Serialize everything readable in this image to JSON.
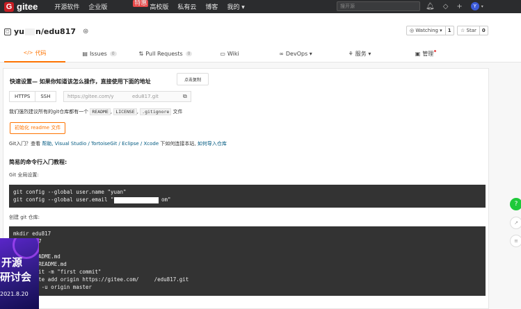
{
  "topnav": {
    "logo_mark": "G",
    "logo_text": "gitee",
    "links": [
      "开源软件",
      "企业版",
      "高校版",
      "私有云",
      "博客",
      "我的 ▾"
    ],
    "enterprise_badge": "特惠",
    "search_placeholder": "搜开源",
    "avatar_letter": "Y"
  },
  "repo": {
    "owner_prefix": "yu",
    "owner_suffix": "n",
    "separator": "/",
    "name": "edu817",
    "watch_label": "◎ Watching ▾",
    "watch_count": "1",
    "star_label": "☆ Star",
    "star_count": "0"
  },
  "tabs": [
    {
      "label": "代码",
      "icon": "</>"
    },
    {
      "label": "Issues",
      "count": "0"
    },
    {
      "label": "Pull Requests",
      "count": "0"
    },
    {
      "label": "Wiki"
    },
    {
      "label": "DevOps ▾"
    },
    {
      "label": "服务 ▾"
    },
    {
      "label": "管理"
    }
  ],
  "quick_setup": {
    "title": "快速设置— 如果你知道该怎么操作，直接使用下面的地址",
    "copy_button": "点击复制",
    "protocols": [
      "HTTPS",
      "SSH"
    ],
    "url_start": "https://gitee.com/y",
    "url_end": "edu817.git",
    "readme_tip_prefix": "我们强烈建议所有的git仓库都有一个",
    "readme_files": [
      "README",
      "LICENSE",
      ".gitignore"
    ],
    "readme_tip_suffix": "文件",
    "init_button": "初始化 readme 文件",
    "intro_prefix": "Git入门？查看",
    "intro_help": "帮助",
    "intro_tools": ", Visual Studio / TortoiseGit / Eclipse / Xcode",
    "intro_mid": "下如何连接本站,",
    "intro_import": "如何导入仓库"
  },
  "tutorial": {
    "heading": "简易的命令行入门教程:",
    "global_label": "Git 全局设置:",
    "global_line1": "git config --global user.name \"yuan\"",
    "global_line2_start": "git config --global user.email \"",
    "global_line2_end": "om\"",
    "create_label": "创建 git 仓库:",
    "create_lines": [
      "mkdir edu817",
      "cd edu817",
      "git init",
      "touch README.md",
      "git add README.md",
      "git commit -m \"first commit\""
    ],
    "remote_start": "git remote add origin https://gitee.com/",
    "remote_end": "/edu817.git",
    "push_line": "git push -u origin master"
  },
  "promo": {
    "line1": "开源",
    "line2": "研讨会",
    "date": "2021.8.20"
  },
  "float": {
    "help": "?"
  }
}
